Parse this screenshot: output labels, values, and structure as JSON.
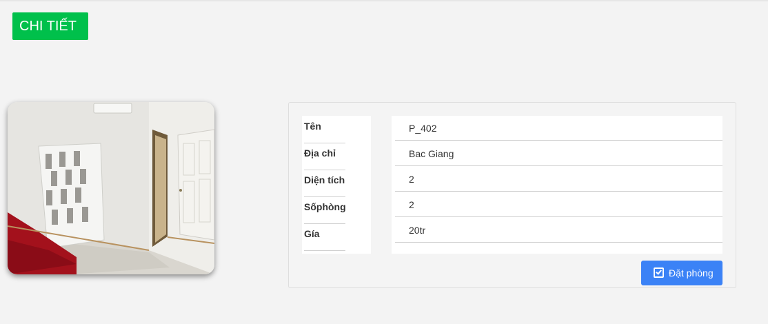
{
  "header": {
    "title": "CHI TIẾT",
    "badge_color": "#00c04b"
  },
  "room": {
    "photo_icon": "room-photo",
    "labels": {
      "name": "Tên",
      "address": "Địa chỉ",
      "area": "Diện tích",
      "rooms": "Sốphòng",
      "price": "Gía"
    },
    "values": {
      "name": "P_402",
      "address": "Bac Giang",
      "area": "2",
      "rooms": "2",
      "price": "20tr"
    }
  },
  "actions": {
    "book_label": "Đặt phòng",
    "book_icon": "check-square-icon",
    "book_color": "#3b82f6"
  }
}
